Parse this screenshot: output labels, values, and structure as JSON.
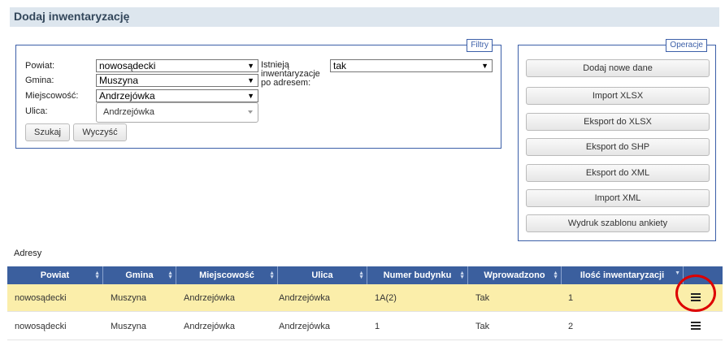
{
  "page_title": "Dodaj inwentaryzację",
  "filters": {
    "legend": "Filtry",
    "powiat": {
      "label": "Powiat:",
      "value": "nowosądecki"
    },
    "gmina": {
      "label": "Gmina:",
      "value": "Muszyna"
    },
    "miejscowosc": {
      "label": "Miejscowość:",
      "value": "Andrzejówka"
    },
    "ulica": {
      "label": "Ulica:",
      "value": "Andrzejówka"
    },
    "istnieja": {
      "label_line1": "Istnieją",
      "label_line2": "inwentaryzacje",
      "label_line3": "po adresem:",
      "value": "tak"
    },
    "search_button": "Szukaj",
    "clear_button": "Wyczyść"
  },
  "operations": {
    "legend": "Operacje",
    "buttons": [
      "Dodaj nowe dane",
      "Import XLSX",
      "Eksport do XLSX",
      "Eksport do SHP",
      "Eksport do XML",
      "Import XML",
      "Wydruk szablonu ankiety"
    ]
  },
  "addresses": {
    "label": "Adresy",
    "columns": [
      "Powiat",
      "Gmina",
      "Miejscowość",
      "Ulica",
      "Numer budynku",
      "Wprowadzono",
      "Ilość inwentaryzacji"
    ],
    "rows": [
      {
        "powiat": "nowosądecki",
        "gmina": "Muszyna",
        "miejscowosc": "Andrzejówka",
        "ulica": "Andrzejówka",
        "numer": "1A(2)",
        "wprowadzono": "Tak",
        "ilosc": "1",
        "selected": true
      },
      {
        "powiat": "nowosądecki",
        "gmina": "Muszyna",
        "miejscowosc": "Andrzejówka",
        "ulica": "Andrzejówka",
        "numer": "1",
        "wprowadzono": "Tak",
        "ilosc": "2",
        "selected": false
      }
    ]
  },
  "icons": {
    "row_menu": "menu-icon",
    "sort": "sort-icon"
  },
  "colors": {
    "header_bg": "#3b5f9e",
    "selected_row": "#fbeeaa",
    "fieldset_border": "#3c5fa8",
    "highlight_circle": "#dd0000"
  }
}
